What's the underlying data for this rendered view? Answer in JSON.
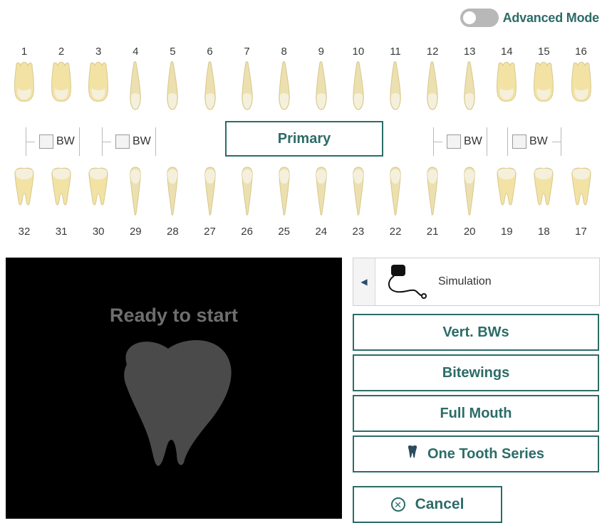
{
  "advanced_mode": {
    "label": "Advanced Mode",
    "enabled": false
  },
  "upper_teeth": [
    "1",
    "2",
    "3",
    "4",
    "5",
    "6",
    "7",
    "8",
    "9",
    "10",
    "11",
    "12",
    "13",
    "14",
    "15",
    "16"
  ],
  "lower_teeth": [
    "32",
    "31",
    "30",
    "29",
    "28",
    "27",
    "26",
    "25",
    "24",
    "23",
    "22",
    "21",
    "20",
    "19",
    "18",
    "17"
  ],
  "bitewing_label": "BW",
  "primary_button": "Primary",
  "preview": {
    "status": "Ready to start"
  },
  "device": {
    "name": "Simulation",
    "icon": "sensor-icon"
  },
  "buttons": {
    "vert_bws": "Vert. BWs",
    "bitewings": "Bitewings",
    "full_mouth": "Full Mouth",
    "one_tooth_series": "One Tooth Series",
    "cancel": "Cancel"
  },
  "colors": {
    "accent": "#2c6c68",
    "tooth_crown": "#f2e3a5",
    "tooth_root": "#ece0b0",
    "panel_bg": "#000000"
  }
}
